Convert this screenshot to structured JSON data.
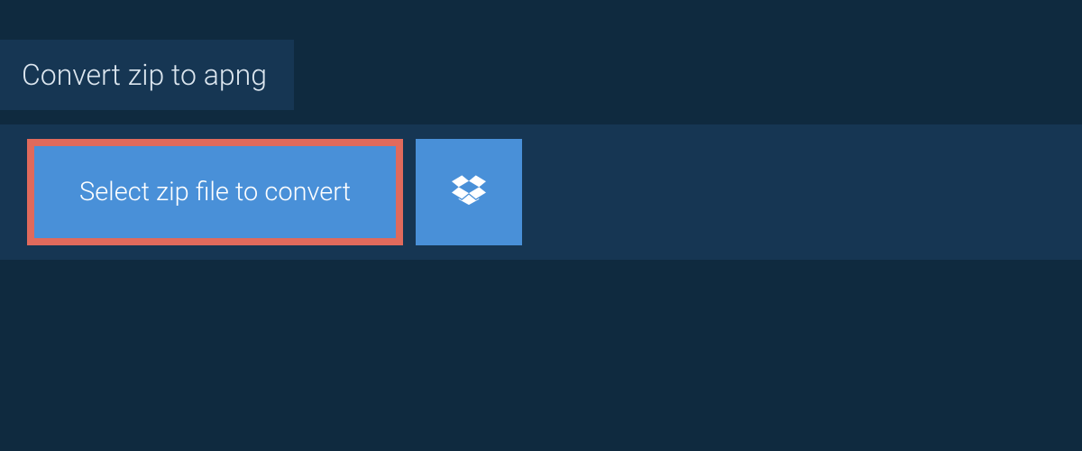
{
  "header": {
    "title": "Convert zip to apng"
  },
  "actions": {
    "select_label": "Select zip file to convert",
    "dropbox_icon": "dropbox-icon"
  },
  "colors": {
    "bg_dark": "#0f2a3f",
    "panel": "#163653",
    "button": "#4990d8",
    "highlight_border": "#e06a5c",
    "text_light": "#ffffff"
  }
}
